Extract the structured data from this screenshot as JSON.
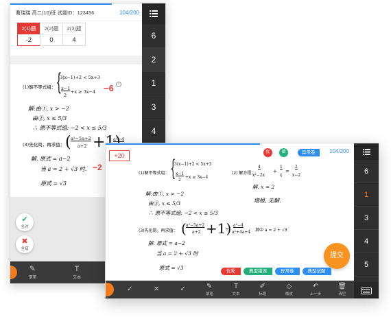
{
  "back_window": {
    "header": {
      "info": "曹瑞瑞   高二(10)班    试题ID：123456",
      "count": "104/200"
    },
    "tabs": [
      {
        "label": "2(1)题",
        "value": "-2",
        "active": true
      },
      {
        "label": "2(2)题",
        "value": "0",
        "active": false
      },
      {
        "label": "2(3)题",
        "value": "4",
        "active": false
      }
    ],
    "sidebar_numbers": [
      "6",
      "2",
      "1",
      "3",
      "4"
    ],
    "problem1": {
      "title": "(1)解不等式组：",
      "line1": "3(x−1)+2 < 5x+3",
      "line2_num": "x−1",
      "line2_den": "2",
      "line2_rest": "+x ≥ 3x−4",
      "score": "−6",
      "hw1": "解:由①,  x > −2",
      "hw2": "由②,   x ≤ 5/3",
      "hw3": "∴ 原不等式组: −2 < x ≤ 5/3"
    },
    "problem3": {
      "title": "(3)先化简，再求值：",
      "expr_num": "a²−5a+2",
      "expr_den": "a+2",
      "expr_num2": "a²−4",
      "hw1": "解. 原式 = a−2",
      "hw2": "当 a = 2 + √3 时.",
      "hw3": "原式 = √3",
      "score": "−2"
    },
    "judge": {
      "right": "全对",
      "wrong": "全错"
    },
    "toolbar": [
      "钢笔",
      "文本",
      "标题"
    ]
  },
  "front_window": {
    "score": "+20",
    "count": "104/200",
    "tags_top": {
      "excellent": "优",
      "wrong": "错",
      "abnormal": "异常卷"
    },
    "sidebar_numbers": [
      "6",
      "1",
      "3",
      "4",
      "5"
    ],
    "problem1": {
      "title": "(1)解不等式组：",
      "line1": "3(x−1)+2 < 5x+3",
      "line2_num": "x−1",
      "line2_den": "2",
      "line2_rest": "+x ≥ 3x−4",
      "hw1": "解:由①,  x > −2",
      "hw2": "由②,   x ≤ 5/3",
      "hw3": "∴ 原不等式组: −2 < x ≤ 5/3"
    },
    "problem2": {
      "title": "(2) 解方程：",
      "frac1_num": "4",
      "frac1_den": "x²−2x",
      "frac2_num": "1",
      "frac2_den": "x",
      "frac3_num": "2",
      "frac3_den": "x−2",
      "hw1": "解. x = 2",
      "hw2": "增根, 无解."
    },
    "problem3": {
      "title": "(3)先化简，再求值：",
      "expr_num": "a²−5a+2",
      "expr_den": "a+2",
      "expr_num2": "a²−4",
      "expr_den2": "a²+4a+4",
      "condition": "其中 a = 2 + √3",
      "hw1": "解. 原式 = a−2",
      "hw2": "当 a = 2 + √3 时",
      "hw3": "原式 = √3"
    },
    "submit": "提交",
    "bottom_tags": [
      "优秀",
      "典型错误",
      "异常卷",
      "典型试题"
    ],
    "toolbar": [
      "钢笔",
      "文本",
      "标题",
      "橡皮",
      "上一步",
      "清空"
    ],
    "colors": {
      "red": "#e53935",
      "green": "#21b07a",
      "blue": "#2d8df0",
      "orange": "#f7931e"
    }
  }
}
